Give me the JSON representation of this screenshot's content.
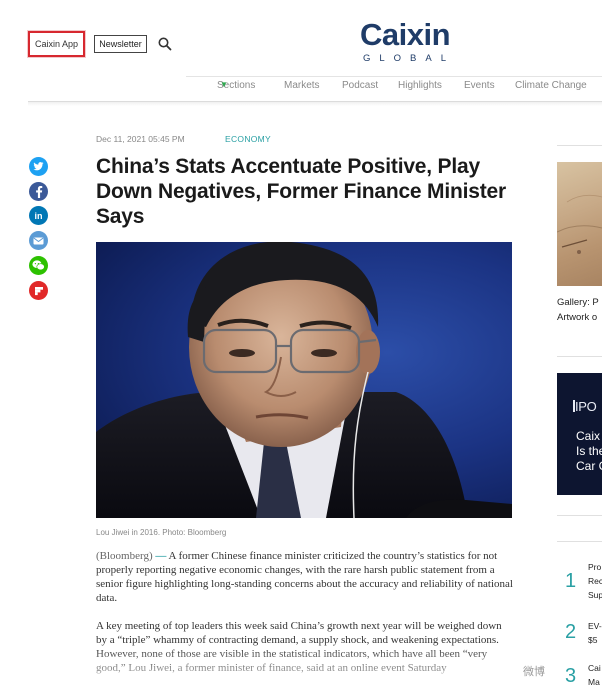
{
  "header": {
    "app_button": "Caixin App",
    "newsletter_button": "Newsletter",
    "logo_word": "Caixin",
    "logo_sub": "GLOBAL"
  },
  "nav": {
    "items": [
      "Sections",
      "Markets",
      "Podcast",
      "Highlights",
      "Events",
      "Climate Change"
    ]
  },
  "article": {
    "date": "Dec 11, 2021 05:45 PM",
    "category": "ECONOMY",
    "headline": "China’s Stats Accentuate Positive, Play Down Negatives, Former Finance Minister Says",
    "caption": "Lou Jiwei in 2016. Photo: Bloomberg",
    "para1_source": "(Bloomberg)",
    "para1_dash": "—",
    "para1_text": "A former Chinese finance minister criticized the country’s statistics for not properly reporting negative economic changes, with the rare harsh public statement from a senior figure highlighting long-standing concerns about the accuracy and reliability of national data.",
    "para2_text": "A key meeting of top leaders this week said China’s growth next year will be weighed down by a “triple” whammy of contracting demand, a supply shock, and weakening expectations. However, none of those are visible in the statistical indicators, which have all been “very good,” Lou Jiwei, a former minister of finance, said at an online event Saturday"
  },
  "share_icons": [
    {
      "name": "twitter-icon",
      "color": "#1da1f2"
    },
    {
      "name": "facebook-icon",
      "color": "#3b5998"
    },
    {
      "name": "linkedin-icon",
      "color": "#0077b5"
    },
    {
      "name": "email-icon",
      "color": "#5b9bd5"
    },
    {
      "name": "wechat-icon",
      "color": "#2dc100"
    },
    {
      "name": "flipboard-icon",
      "color": "#e12828"
    }
  ],
  "sidebar": {
    "gallery_caption_1": "Gallery: P",
    "gallery_caption_2": "Artwork o",
    "ipo_title": "IPO",
    "ipo_lines": [
      "Caix",
      "Is the",
      "Car C"
    ],
    "trending": [
      {
        "num": "1",
        "lines": [
          "Pro",
          "Rec",
          "Sup"
        ]
      },
      {
        "num": "2",
        "lines": [
          "EV-",
          "$5"
        ]
      },
      {
        "num": "3",
        "lines": [
          "Cai",
          "Ma"
        ]
      }
    ]
  },
  "watermark": "微博"
}
